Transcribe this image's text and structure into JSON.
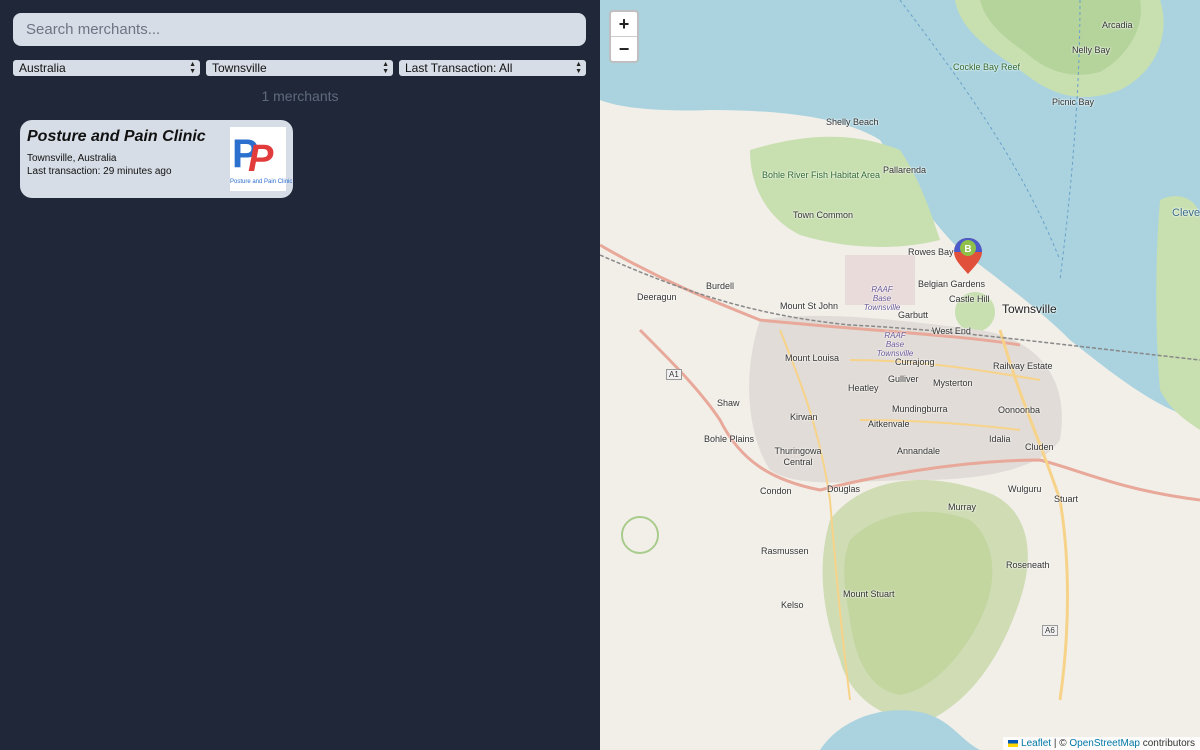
{
  "search": {
    "placeholder": "Search merchants..."
  },
  "filters": {
    "country": "Australia",
    "city": "Townsville",
    "last_transaction": "Last Transaction: All"
  },
  "count_text": "1 merchants",
  "merchants": [
    {
      "name": "Posture and Pain Clinic",
      "location": "Townsville, Australia",
      "last_transaction": "Last transaction: 29 minutes ago",
      "logo_text": "Posture and Pain Clinic"
    }
  ],
  "map": {
    "zoom_in": "+",
    "zoom_out": "−",
    "labels": {
      "arcadia": "Arcadia",
      "nelly_bay": "Nelly Bay",
      "cockle_bay_reef": "Cockle Bay Reef",
      "picnic_bay": "Picnic Bay",
      "cleveland_bay": "Cleve Bay - M Island N Prote Ar",
      "shelly_beach": "Shelly Beach",
      "pallarenda": "Pallarenda",
      "bohle_river": "Bohle River Fish Habitat Area",
      "town_common": "Town Common",
      "rowes_bay": "Rowes Bay",
      "deeragun": "Deeragun",
      "burdell": "Burdell",
      "raaf_base": "RAAF Base Townsville",
      "raaf_base_2": "RAAF Base Townsville",
      "belgian_gardens": "Belgian Gardens",
      "castle_hill": "Castle Hill",
      "townsville": "Townsville",
      "mount_st_john": "Mount St John",
      "garbutt": "Garbutt",
      "west_end": "West End",
      "mount_louisa": "Mount Louisa",
      "currajong": "Currajong",
      "railway_estate": "Railway Estate",
      "a1": "A1",
      "heatley": "Heatley",
      "gulliver": "Gulliver",
      "mysterton": "Mysterton",
      "shaw": "Shaw",
      "kirwan": "Kirwan",
      "mundingburra": "Mundingburra",
      "oonoonba": "Oonoonba",
      "aitkenvale": "Aitkenvale",
      "bohle_plains": "Bohle Plains",
      "idalia": "Idalia",
      "cluden": "Cluden",
      "thuringowa": "Thuringowa Central",
      "annandale": "Annandale",
      "condon": "Condon",
      "douglas": "Douglas",
      "wulguru": "Wulguru",
      "murray": "Murray",
      "stuart": "Stuart",
      "rasmussen": "Rasmussen",
      "roseneath": "Roseneath",
      "mount_stuart": "Mount Stuart",
      "kelso": "Kelso",
      "a6": "A6"
    },
    "attribution": {
      "leaflet": "Leaflet",
      "sep": "| ©",
      "osm": "OpenStreetMap",
      "contributors": "contributors"
    },
    "colors": {
      "water": "#aad3df",
      "land": "#f2efe9",
      "park": "#c8dfb0",
      "marker_top": "#4a5ac8",
      "marker_bottom": "#e0503a"
    }
  }
}
